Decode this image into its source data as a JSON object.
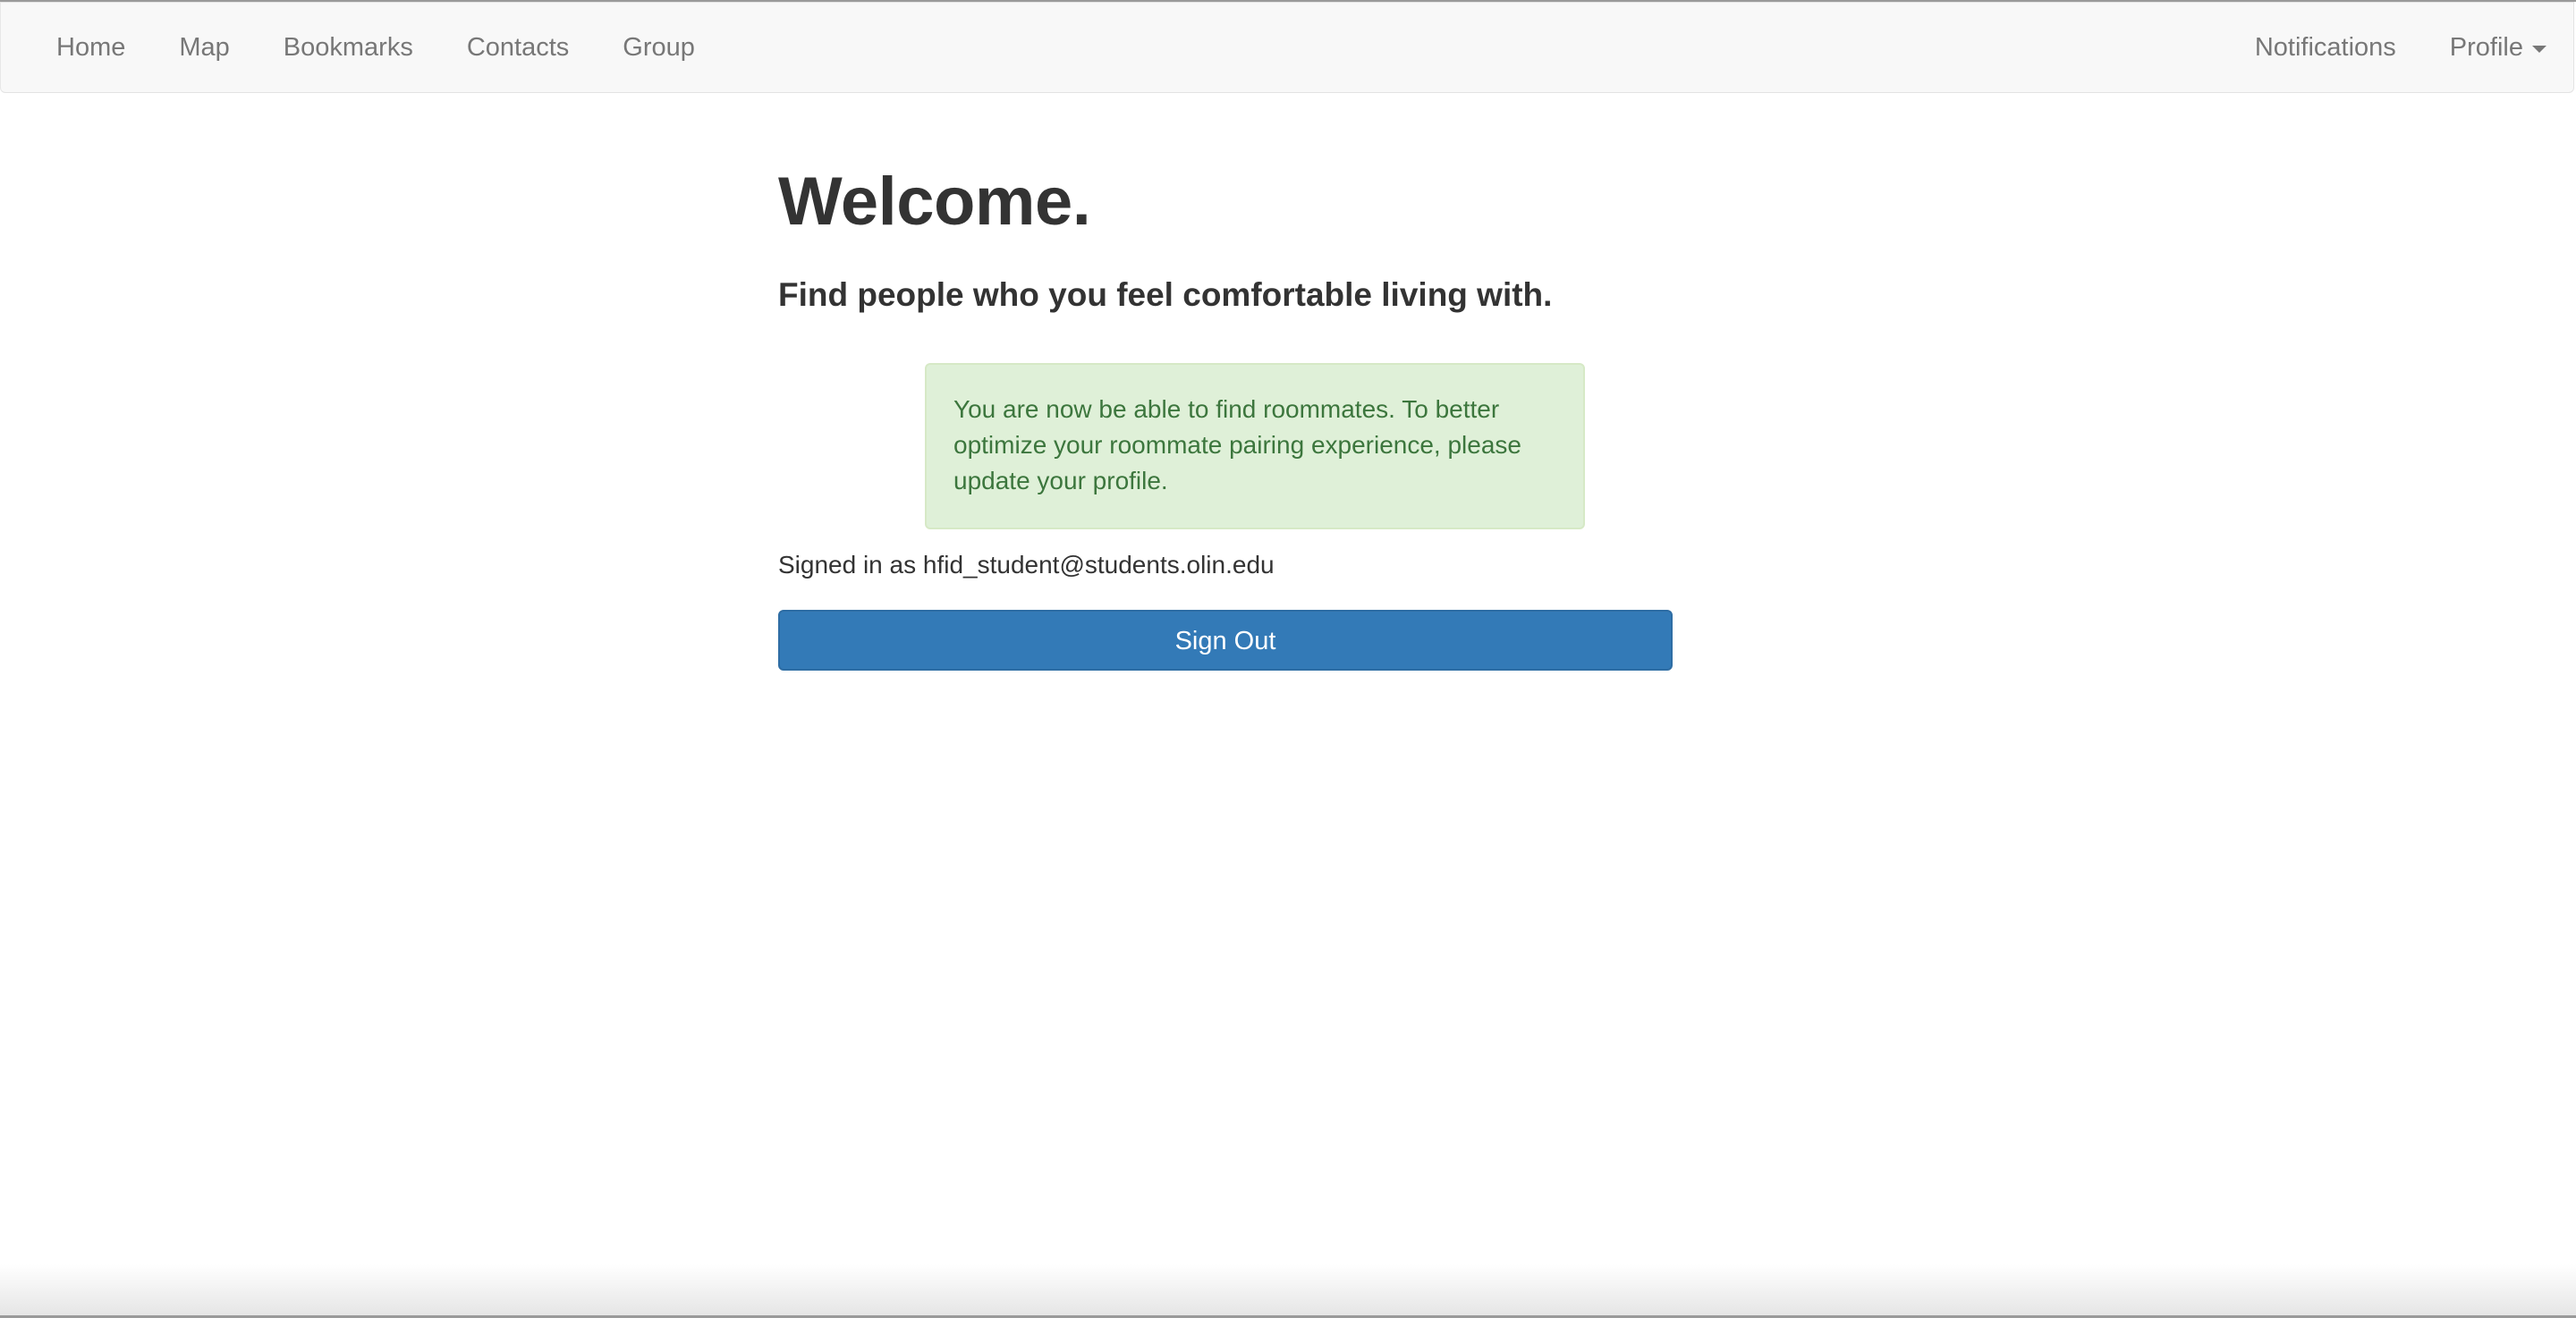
{
  "nav": {
    "left_items": [
      "Home",
      "Map",
      "Bookmarks",
      "Contacts",
      "Group"
    ],
    "notifications_label": "Notifications",
    "profile_label": "Profile"
  },
  "main": {
    "title": "Welcome.",
    "tagline": "Find people who you feel comfortable living with.",
    "alert_text": "You are now be able to find roommates. To better optimize your roommate pairing experience, please update your profile.",
    "signed_in_text": "Signed in as hfid_student@students.olin.edu",
    "signout_label": "Sign Out"
  },
  "colors": {
    "navbar_bg": "#f8f8f8",
    "nav_text": "#777777",
    "alert_bg": "#dff0d8",
    "alert_text": "#3c763d",
    "primary_button": "#337ab7"
  }
}
